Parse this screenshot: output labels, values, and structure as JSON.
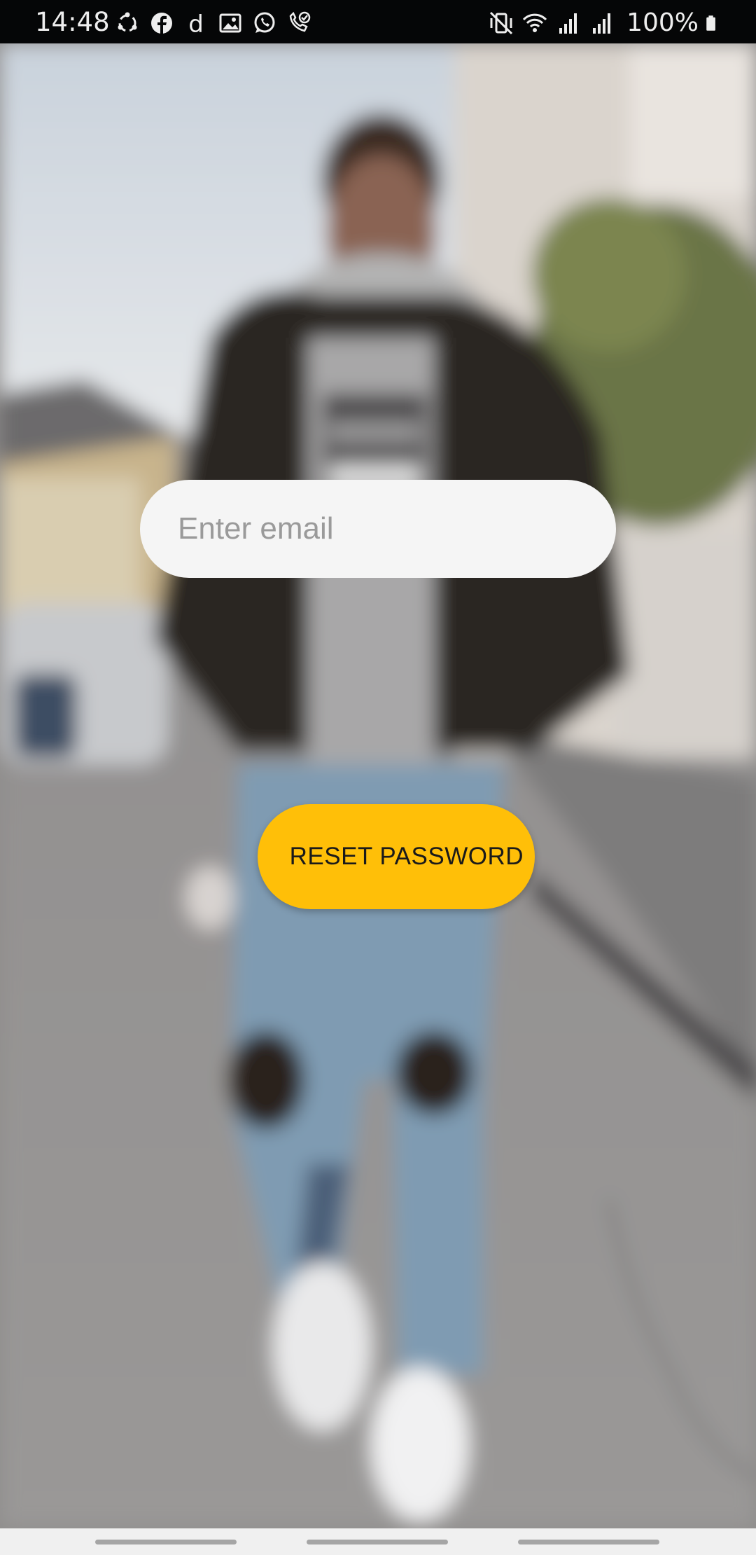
{
  "status_bar": {
    "time": "14:48",
    "left_icons": [
      "sync-icon",
      "facebook-icon",
      "d-app-icon",
      "gallery-icon",
      "whatsapp-icon",
      "wifi-call-icon"
    ],
    "right_icons": [
      "mute-vibrate-icon",
      "wifi-icon",
      "signal-icon",
      "signal-icon-2",
      "battery-icon"
    ],
    "battery_text": "100%"
  },
  "form": {
    "email_placeholder": "Enter email",
    "email_value": "",
    "reset_button_label": "RESET PASSWORD"
  },
  "colors": {
    "accent": "#ffbf08",
    "input_background": "#f5f5f5",
    "status_bar_background": "#050607",
    "nav_bar_background": "#f0f0f0"
  },
  "navigation_bar": [
    "recents-button",
    "home-button",
    "back-button"
  ]
}
